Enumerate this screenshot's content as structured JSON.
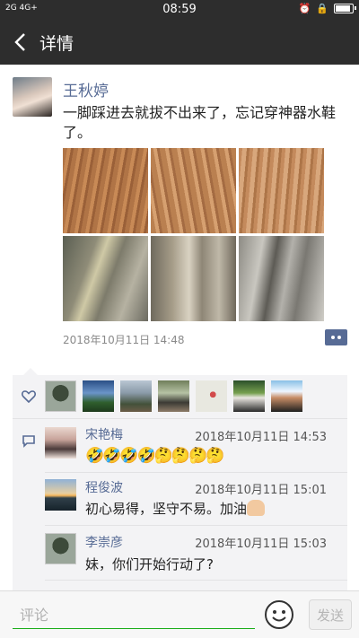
{
  "status_bar": {
    "signal_text": "2G 4G+",
    "time": "08:59"
  },
  "title_bar": {
    "title": "详情"
  },
  "post": {
    "author": "王秋婷",
    "text": "一脚踩进去就拔不出来了，忘记穿神器水鞋了。",
    "timestamp": "2018年10月11日 14:48",
    "photo_count": 6
  },
  "likes": {
    "count": 7
  },
  "comments": [
    {
      "author": "宋艳梅",
      "time": "2018年10月11日 14:53",
      "text": "🤣🤣🤣🤣🤔🤔🤔🤔"
    },
    {
      "author": "程俊波",
      "time": "2018年10月11日 15:01",
      "text": "初心易得，坚守不易。加油"
    },
    {
      "author": "李崇彦",
      "time": "2018年10月11日 15:03",
      "text": "妹，你们开始行动了?"
    }
  ],
  "bottom_bar": {
    "placeholder": "评论",
    "send_label": "发送"
  },
  "colors": {
    "header_bg": "#2d2d2d",
    "name_blue": "#576b95",
    "accent_green": "#1aad19"
  }
}
